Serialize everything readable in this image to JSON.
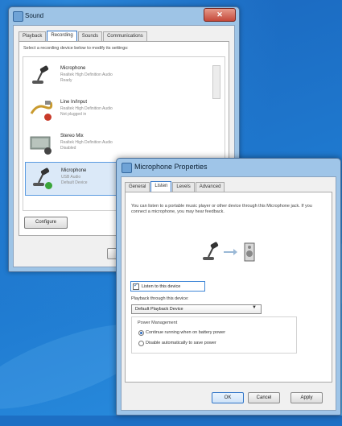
{
  "sound_window": {
    "title": "Sound",
    "close_glyph": "✕",
    "tabs": [
      "Playback",
      "Recording",
      "Sounds",
      "Communications"
    ],
    "instruction": "Select a recording device below to modify its settings:",
    "devices": [
      {
        "name": "Microphone",
        "sub": "Realtek High Definition Audio",
        "status": "Ready",
        "icon": "microphone-icon",
        "badge": ""
      },
      {
        "name": "Line In/Input",
        "sub": "Realtek High Definition Audio",
        "status": "Not plugged in",
        "icon": "line-in-icon",
        "badge": "red"
      },
      {
        "name": "Stereo Mix",
        "sub": "Realtek High Definition Audio",
        "status": "Disabled",
        "icon": "stereo-mix-icon",
        "badge": "dark"
      },
      {
        "name": "Microphone",
        "sub": "USB Audio",
        "status": "Default Device",
        "icon": "microphone-icon",
        "badge": "green"
      }
    ],
    "configure_label": "Configure"
  },
  "mic_window": {
    "title": "Microphone Properties",
    "tabs": [
      "General",
      "Listen",
      "Levels",
      "Advanced"
    ],
    "description": "You can listen to a portable music player or other device through this Microphone jack. If you connect a microphone, you may hear feedback.",
    "listen_checkbox_label": "Listen to this device",
    "playback_label": "Playback through this device:",
    "playback_value": "Default Playback Device",
    "dropdown_arrow": "▼",
    "power_group_title": "Power Management",
    "power_options": [
      "Continue running when on battery power",
      "Disable automatically to save power"
    ],
    "buttons": {
      "ok": "OK",
      "cancel": "Cancel",
      "apply": "Apply"
    }
  },
  "colors": {
    "desktop": "#1d6fc4",
    "selection_border": "#2f74c7",
    "badge_green": "#3aa53a",
    "badge_red": "#c83a2a"
  }
}
